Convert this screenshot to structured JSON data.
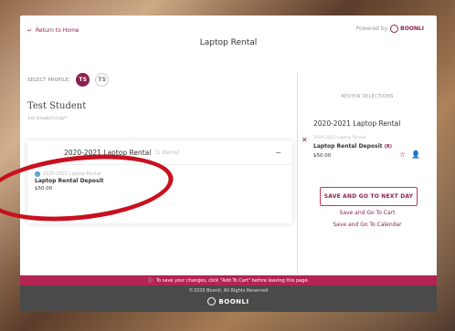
{
  "header": {
    "return_link": "Return to Home",
    "title": "Laptop Rental",
    "powered_by": "Powered by",
    "brand": "BOONLI"
  },
  "profile": {
    "label": "SELECT PROFILE:",
    "avatars": [
      "TS",
      "TS"
    ]
  },
  "student": {
    "name": "Test Student",
    "grade": "1st Grade/1/1st/*"
  },
  "left_panel": {
    "title": "2020-2021 Laptop Rental",
    "count": "(1 Items)",
    "item": {
      "category": "2020-2021 Laptop Rental",
      "name": "Laptop Rental Deposit",
      "price": "$50.00"
    }
  },
  "right_panel": {
    "title": "REVIEW SELECTIONS",
    "heading": "2020-2021 Laptop Rental",
    "item_category": "2020-2021 Laptop Rental",
    "item_name": "Laptop Rental Deposit",
    "item_tag": "(R)",
    "item_price": "$50.00",
    "save_next": "SAVE AND GO TO NEXT DAY",
    "save_cart": "Save and Go To Cart",
    "save_calendar": "Save and Go To Calendar"
  },
  "banner": {
    "message": "To save your changes, click \"Add To Cart\" before leaving this page."
  },
  "footer": {
    "copyright": "©2020 Boonli, All Rights Reserved",
    "brand": "BOONLI"
  },
  "colors": {
    "accent": "#8b2050",
    "banner": "#b32453",
    "footer": "#4a4a4a",
    "annotation": "#c8101e"
  }
}
